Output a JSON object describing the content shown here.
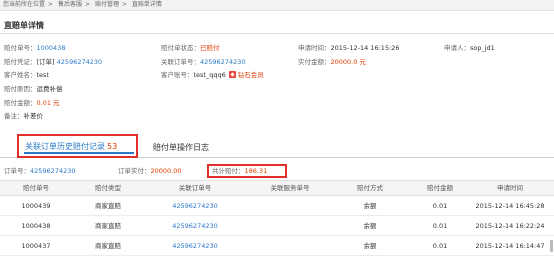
{
  "breadcrumb": {
    "prefix": "您当前所在位置",
    "sep": ">",
    "items": [
      "售后客服",
      "赔付管理",
      "直赔单详情"
    ]
  },
  "page": {
    "title": "直赔单详情"
  },
  "info": {
    "row1": {
      "order_no_label": "赔付单号：",
      "order_no": "1000438",
      "status_label": "赔付单状态：",
      "status": "已赔付",
      "apply_time_label": "申请时间：",
      "apply_time": "2015-12-14 16:15:26",
      "applicant_label": "申请人：",
      "applicant": "sop_jd1"
    },
    "row2": {
      "voucher_label": "赔付凭证：",
      "voucher_prefix": "[订单]",
      "voucher": "42596274230",
      "linked_label": "关联订单号：",
      "linked": "42596274230",
      "paid_label": "实付金额：",
      "paid": "20000.0 元"
    },
    "row3": {
      "customer_name_label": "客户姓名：",
      "customer_name": "test",
      "account_label": "客户账号：",
      "account": "test_qqq6",
      "member_level": "钻石会员"
    },
    "row4": {
      "reason_label": "赔付原因：",
      "reason": "运费补偿"
    },
    "row5": {
      "amount_label": "赔付金额：",
      "amount": "0.01 元"
    },
    "row6": {
      "remark_label": "备注：",
      "remark": "补差价"
    }
  },
  "tabs": {
    "active": {
      "label": "关联订单历史赔付记录",
      "count": "53"
    },
    "inactive": {
      "label": "赔付单操作日志"
    }
  },
  "summary": {
    "order_label": "订单号：",
    "order": "42596274230",
    "paid_label": "订单实付：",
    "paid": "20000.00",
    "total_label": "共计赔付：",
    "total": "186.31"
  },
  "table": {
    "headers": [
      "赔付单号",
      "赔付类型",
      "关联订单号",
      "关联服务单号",
      "赔付方式",
      "赔付金额",
      "申请时间"
    ],
    "rows": [
      [
        "1000439",
        "商家直赔",
        "42596274230",
        "",
        "余额",
        "0.01",
        "2015-12-14 16:45:28"
      ],
      [
        "1000438",
        "商家直赔",
        "42596274230",
        "",
        "余额",
        "0.01",
        "2015-12-14 16:22:24"
      ],
      [
        "1000437",
        "商家直赔",
        "42596274230",
        "",
        "余额",
        "0.01",
        "2015-12-14 16:14:47"
      ]
    ]
  },
  "colors": {
    "link": "#2a78c6",
    "accent_red": "#e03c00",
    "highlight_border": "#e0302a",
    "badge": "#e8463c"
  }
}
